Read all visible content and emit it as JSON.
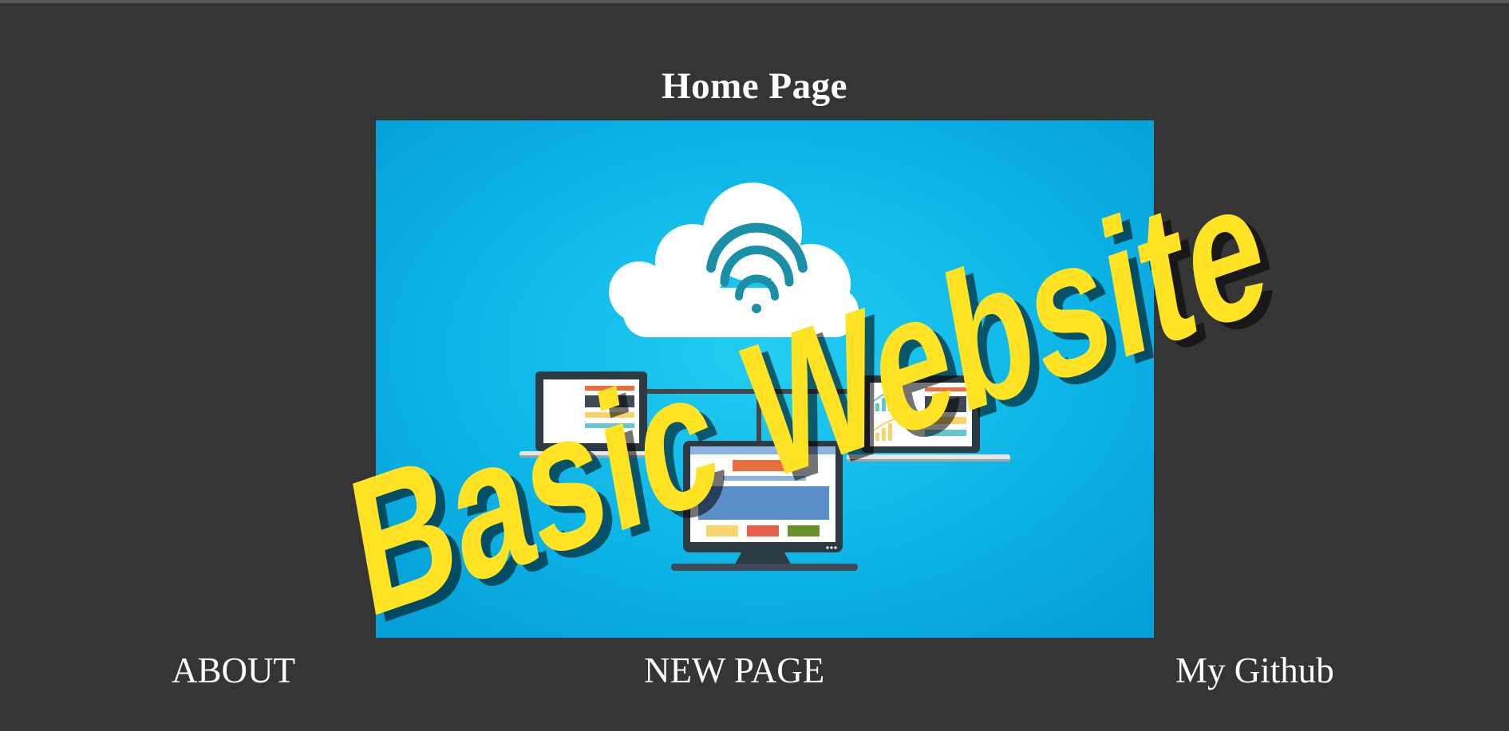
{
  "page": {
    "title": "Home Page"
  },
  "hero": {
    "banner_text": "Basic Website",
    "background_color": "#0aa6dc",
    "banner_color": "#ffe324",
    "icons": [
      "cloud-icon",
      "wifi-icon",
      "laptop-icon",
      "desktop-monitor-icon",
      "chart-icon"
    ]
  },
  "nav": {
    "about_label": "ABOUT",
    "new_page_label": "NEW PAGE",
    "github_label": "My Github"
  },
  "colors": {
    "page_background": "#353535",
    "text": "#ffffff"
  }
}
